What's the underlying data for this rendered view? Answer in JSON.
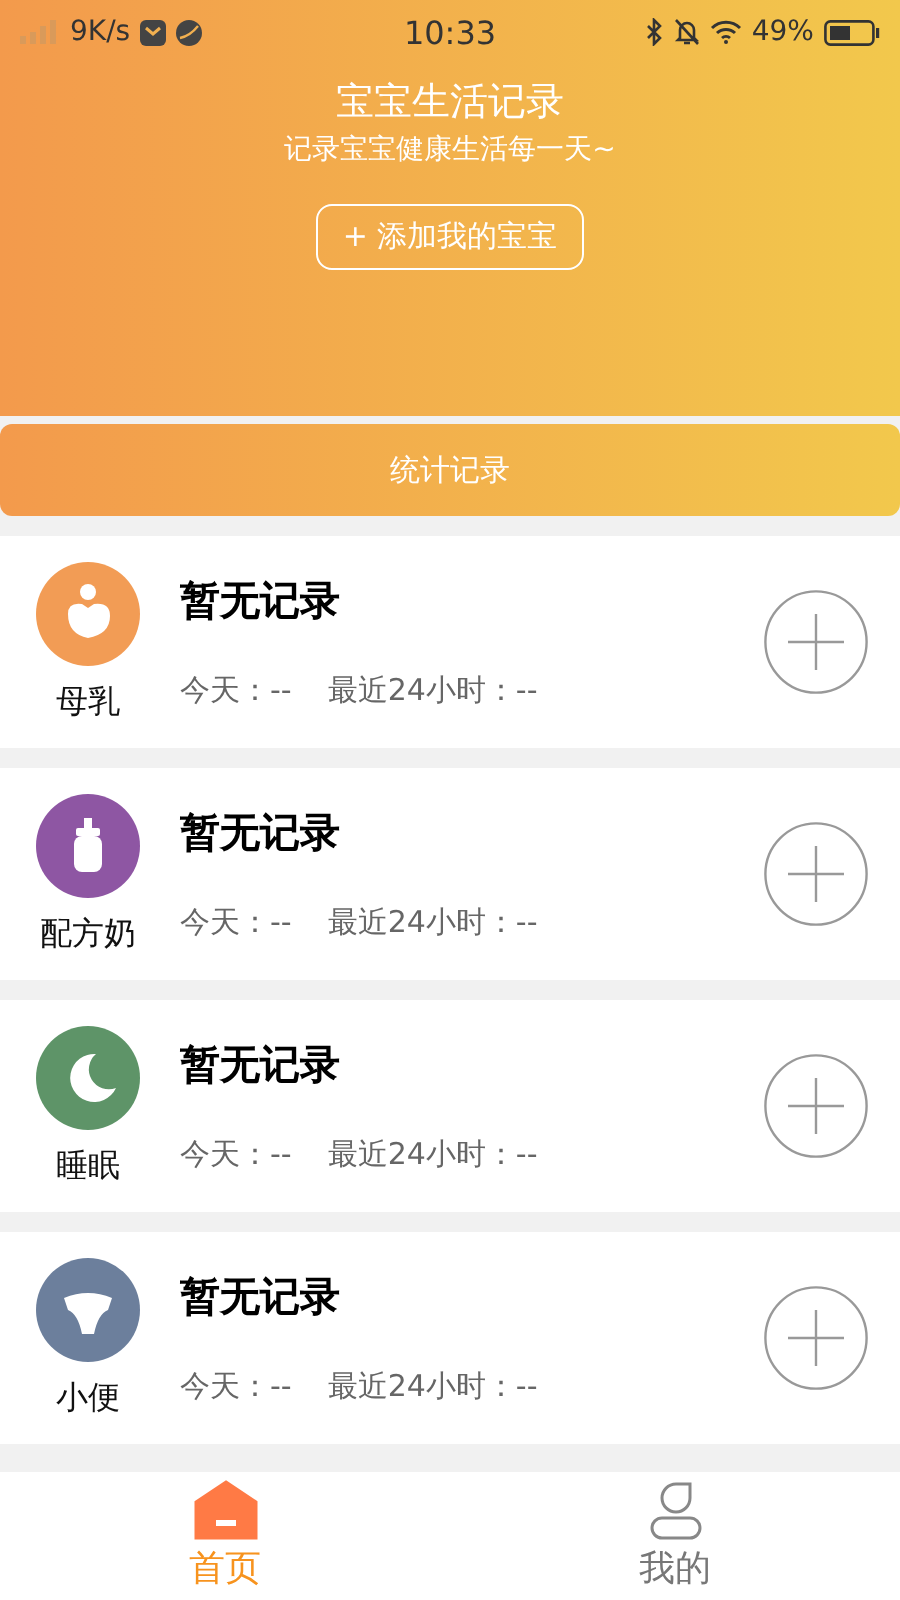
{
  "status_bar": {
    "speed": "9K/s",
    "time": "10:33",
    "battery": "49%"
  },
  "header": {
    "title": "宝宝生活记录",
    "subtitle": "记录宝宝健康生活每一天~",
    "add_button": "+ 添加我的宝宝"
  },
  "stats_button": "统计记录",
  "records": [
    {
      "kind": "breast",
      "name": "母乳",
      "color": "#f29c55",
      "title": "暂无记录",
      "today": "今天：--",
      "recent": "最近24小时：--"
    },
    {
      "kind": "bottle",
      "name": "配方奶",
      "color": "#8e56a3",
      "title": "暂无记录",
      "today": "今天：--",
      "recent": "最近24小时：--"
    },
    {
      "kind": "sleep",
      "name": "睡眠",
      "color": "#5e9468",
      "title": "暂无记录",
      "today": "今天：--",
      "recent": "最近24小时：--"
    },
    {
      "kind": "diaper",
      "name": "小便",
      "color": "#6c7f9c",
      "title": "暂无记录",
      "today": "今天：--",
      "recent": "最近24小时：--"
    }
  ],
  "tabs": [
    {
      "kind": "home",
      "label": "首页",
      "selected": true
    },
    {
      "kind": "me",
      "label": "我的",
      "selected": false
    }
  ]
}
